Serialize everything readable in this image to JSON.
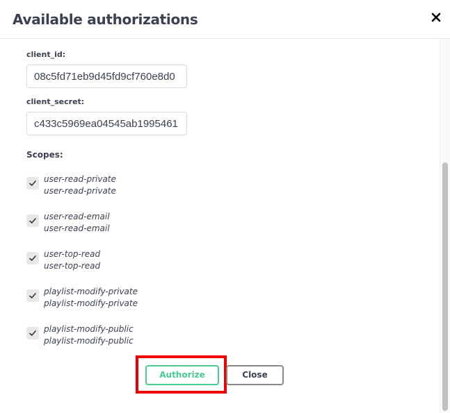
{
  "dialog": {
    "title": "Available authorizations"
  },
  "form": {
    "client_id_label": "client_id:",
    "client_id_value": "08c5fd71eb9d45fd9cf760e8d0",
    "client_secret_label": "client_secret:",
    "client_secret_value": "c433c5969ea04545ab1995461",
    "scopes_label": "Scopes:"
  },
  "scopes": [
    {
      "name": "user-read-private",
      "description": "user-read-private",
      "checked": true
    },
    {
      "name": "user-read-email",
      "description": "user-read-email",
      "checked": true
    },
    {
      "name": "user-top-read",
      "description": "user-top-read",
      "checked": true
    },
    {
      "name": "playlist-modify-private",
      "description": "playlist-modify-private",
      "checked": true
    },
    {
      "name": "playlist-modify-public",
      "description": "playlist-modify-public",
      "checked": true
    }
  ],
  "buttons": {
    "authorize_label": "Authorize",
    "close_label": "Close"
  },
  "icons": {
    "close": "close-icon",
    "check": "check-icon"
  },
  "colors": {
    "accent": "#49cc90",
    "highlight": "#ee0000",
    "text": "#3b4151"
  }
}
